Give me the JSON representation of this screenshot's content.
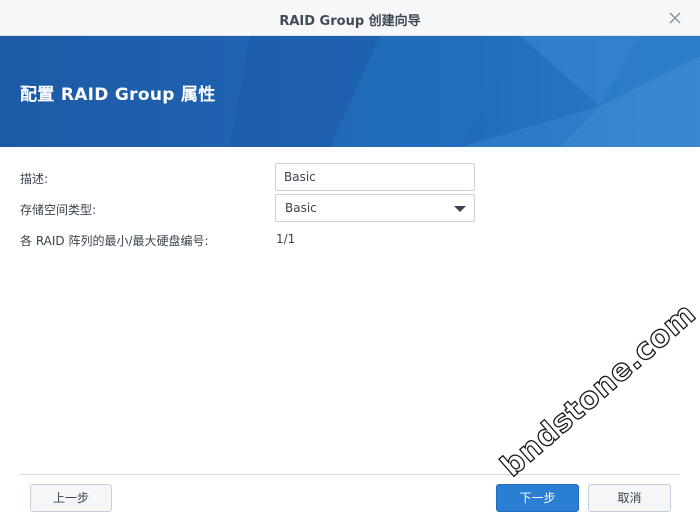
{
  "window": {
    "title": "RAID Group 创建向导",
    "close_icon": "close-icon"
  },
  "banner": {
    "heading": "配置 RAID Group 属性"
  },
  "form": {
    "description": {
      "label": "描述:",
      "value": "Basic"
    },
    "storage_type": {
      "label": "存储空间类型:",
      "selected": "Basic"
    },
    "disk_count": {
      "label": "各 RAID 阵列的最小/最大硬盘编号:",
      "value": "1/1"
    }
  },
  "footer": {
    "back_label": "上一步",
    "next_label": "下一步",
    "cancel_label": "取消"
  },
  "watermark": "bndstone.com",
  "colors": {
    "banner": "#1f63b0",
    "primary_button": "#2a7fd4"
  }
}
